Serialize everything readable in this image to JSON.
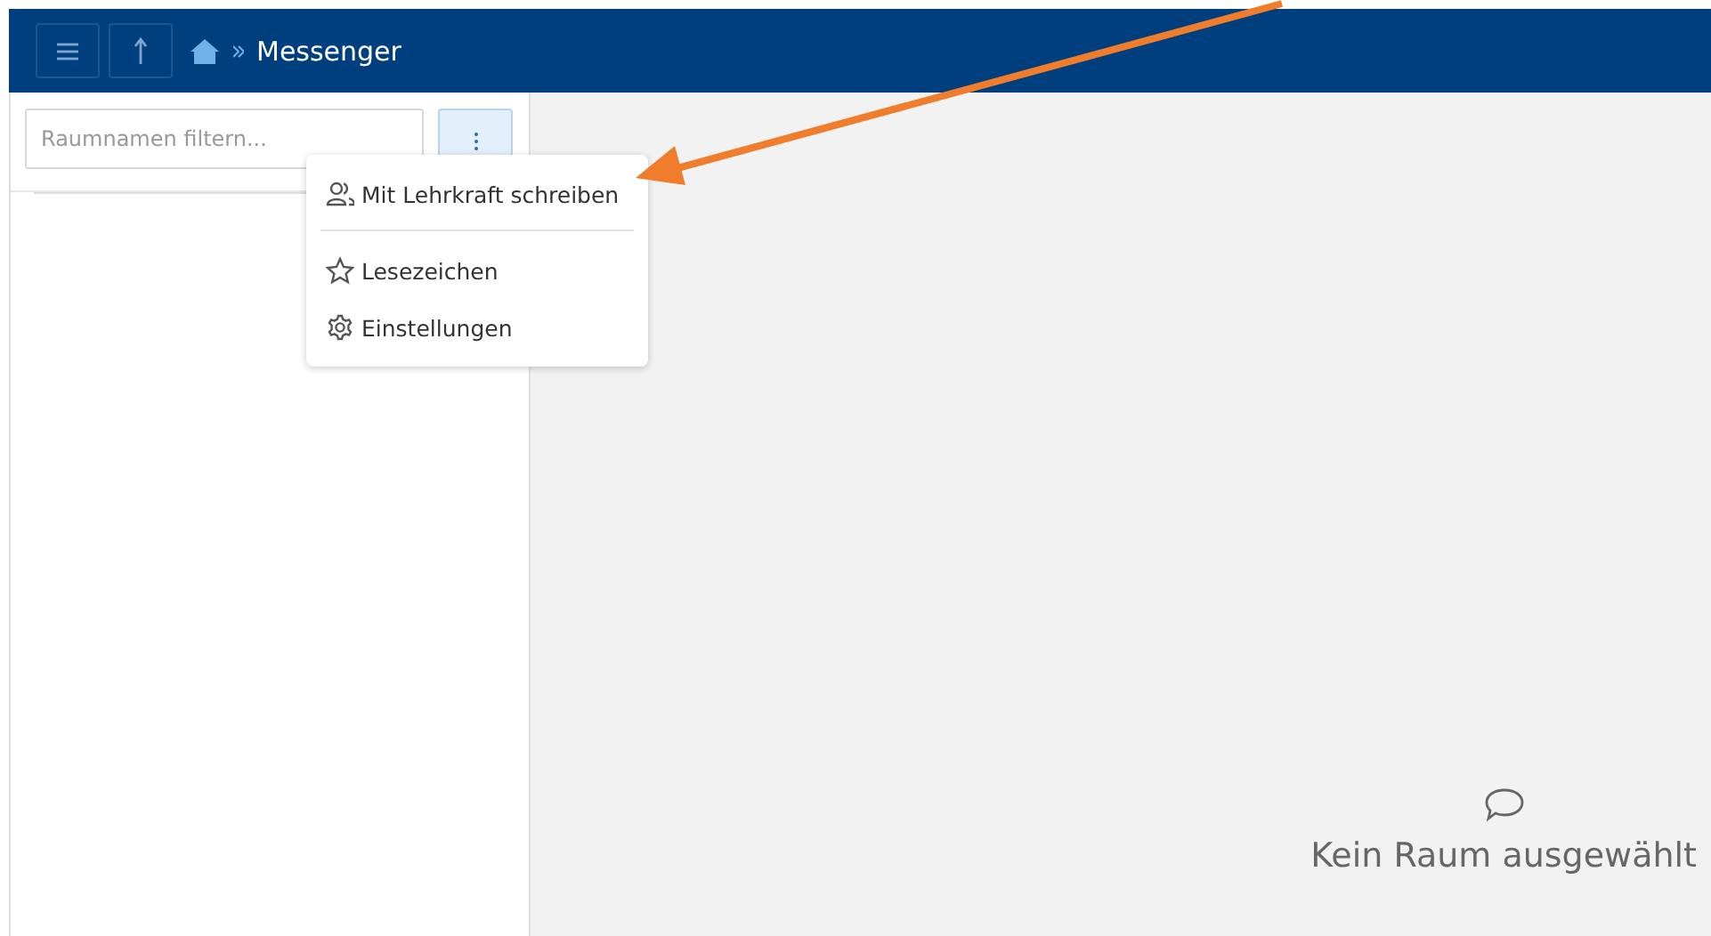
{
  "header": {
    "title": "Messenger"
  },
  "sidebar": {
    "filter": {
      "placeholder": "Raumnamen filtern..."
    },
    "menu_button": {
      "expanded": true
    }
  },
  "menu": {
    "items": [
      {
        "kind": "people",
        "label": "Mit Lehrkraft schreiben",
        "divider_after": true
      },
      {
        "kind": "star",
        "label": "Lesezeichen",
        "divider_after": false
      },
      {
        "kind": "gear",
        "label": "Einstellungen",
        "divider_after": false
      }
    ]
  },
  "empty_state": {
    "text": "Kein Raum ausgewählt"
  }
}
